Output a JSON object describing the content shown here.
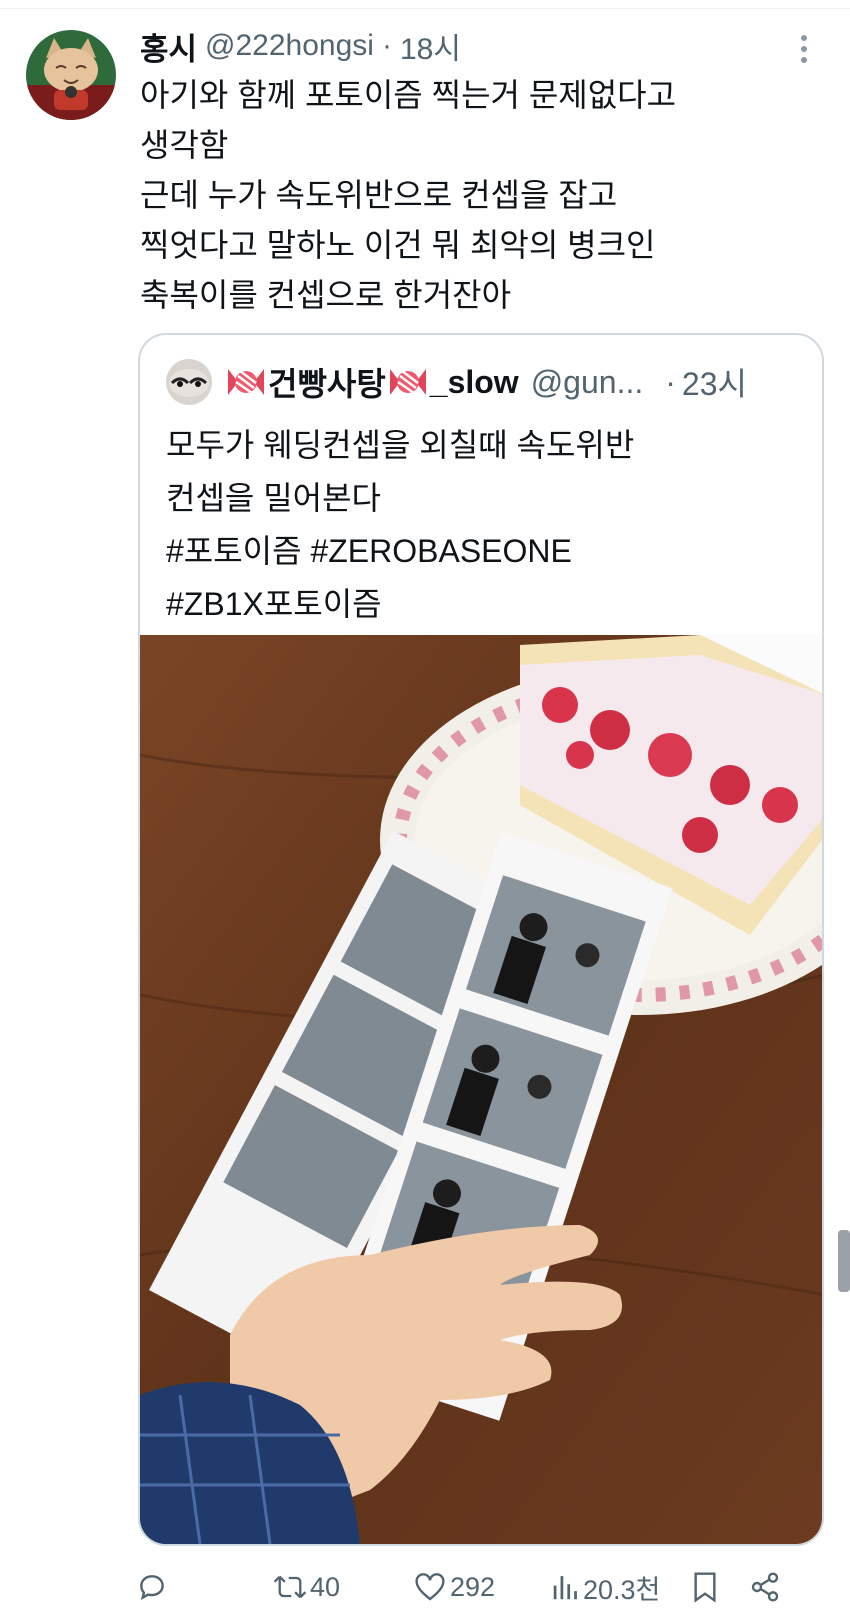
{
  "tweet": {
    "author_name": "홍시",
    "author_handle": "@222hongsi",
    "separator": "·",
    "time": "18시",
    "text": "아기와 함께 포토이즘 찍는거 문제없다고\n생각함\n근데 누가 속도위반으로 컨셉을 잡고\n찍엇다고 말하노 이건 뭐 최악의 병크인\n축복이를 컨셉으로 한거잔아",
    "avatar_icon": "cat-avatar-icon",
    "more_icon": "more-vertical-icon"
  },
  "quote": {
    "author_name": "건빵사탕",
    "author_suffix": "_slow",
    "author_handle": "@gun...",
    "separator": "·",
    "time": "23시",
    "text": "모두가 웨딩컨셉을 외칠때 속도위반\n컨셉을 밀어본다\n#포토이즘 #ZEROBASEONE\n#ZB1X포토이즘",
    "emoji_icon": "candy-emoji-icon",
    "photo_description_icon": "photo-strip-cake-image"
  },
  "actions": {
    "reply": {
      "icon": "reply-icon",
      "count": ""
    },
    "retweet": {
      "icon": "retweet-icon",
      "count": "40"
    },
    "like": {
      "icon": "heart-icon",
      "count": "292"
    },
    "views": {
      "icon": "views-icon",
      "count": "20.3천"
    },
    "bookmark": {
      "icon": "bookmark-icon"
    },
    "share": {
      "icon": "share-icon"
    }
  },
  "colors": {
    "text": "#0f1419",
    "secondary": "#536471",
    "border": "#cfd9de",
    "table_wood": "#6b3a1f"
  }
}
